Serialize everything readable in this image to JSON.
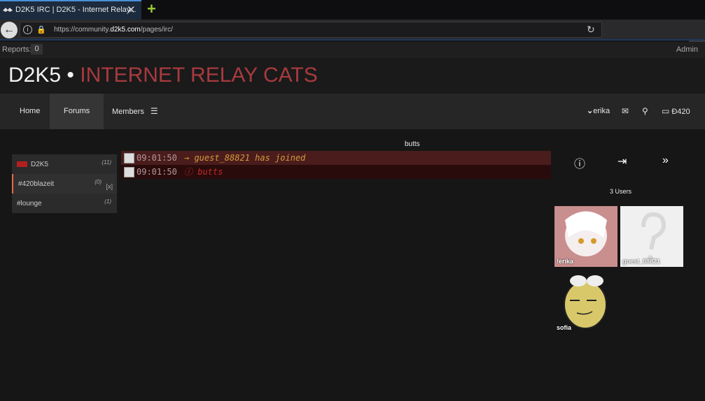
{
  "browser": {
    "tab_title": "D2K5 IRC | D2K5 - Internet Relay...",
    "url_prefix": "https://community.",
    "url_domain": "d2k5.com",
    "url_path": "/pages/irc/"
  },
  "topbar": {
    "reports_label": "Reports:",
    "reports_count": "0",
    "admin_label": "Admin"
  },
  "site": {
    "name": "D2K5",
    "sep": " • ",
    "tagline": "INTERNET RELAY CATS"
  },
  "nav": {
    "home": "Home",
    "forums": "Forums",
    "members": "Members",
    "user": "erika",
    "balance": "Đ420"
  },
  "chat": {
    "channel_title": "butts"
  },
  "channels": [
    {
      "name": "D2K5",
      "count": "(11)"
    },
    {
      "name": "#420blazeit",
      "count": "(0)",
      "close": "[x]"
    },
    {
      "name": "#lounge",
      "count": "(1)"
    }
  ],
  "messages": [
    {
      "time": "09:01:50",
      "text": "→ guest_88821 has joined"
    },
    {
      "time": "09:01:50",
      "text": "ⓘ butts"
    }
  ],
  "users_panel": {
    "count_label": "3 Users",
    "users": [
      {
        "name": "!erika"
      },
      {
        "name": "guest_88821"
      },
      {
        "name": "sofia"
      }
    ]
  }
}
